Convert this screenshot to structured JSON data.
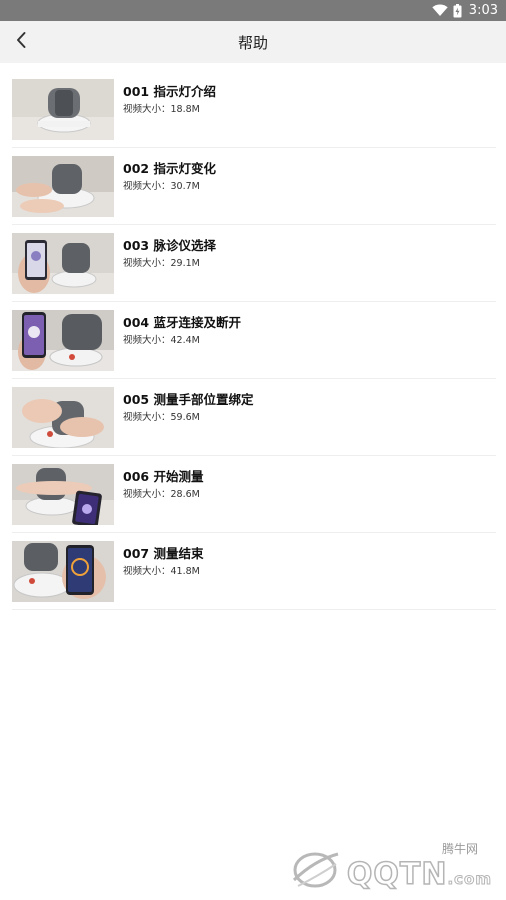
{
  "status_bar": {
    "time": "3:03"
  },
  "app_bar": {
    "title": "帮助"
  },
  "videos": [
    {
      "title": "001 指示灯介绍",
      "size": "视频大小：18.8M",
      "thumb": "device"
    },
    {
      "title": "002 指示灯变化",
      "size": "视频大小：30.7M",
      "thumb": "hands"
    },
    {
      "title": "003 脉诊仪选择",
      "size": "视频大小：29.1M",
      "thumb": "phone"
    },
    {
      "title": "004 蓝牙连接及断开",
      "size": "视频大小：42.4M",
      "thumb": "phone-purple"
    },
    {
      "title": "005 测量手部位置绑定",
      "size": "视频大小：59.6M",
      "thumb": "hands-close"
    },
    {
      "title": "006 开始测量",
      "size": "视频大小：28.6M",
      "thumb": "wrist-phone"
    },
    {
      "title": "007 测量结束",
      "size": "视频大小：41.8M",
      "thumb": "wrist-phone-hand"
    }
  ],
  "watermark": {
    "brand_cn": "腾牛网",
    "brand_en": "QQTN",
    "domain": ".com"
  }
}
